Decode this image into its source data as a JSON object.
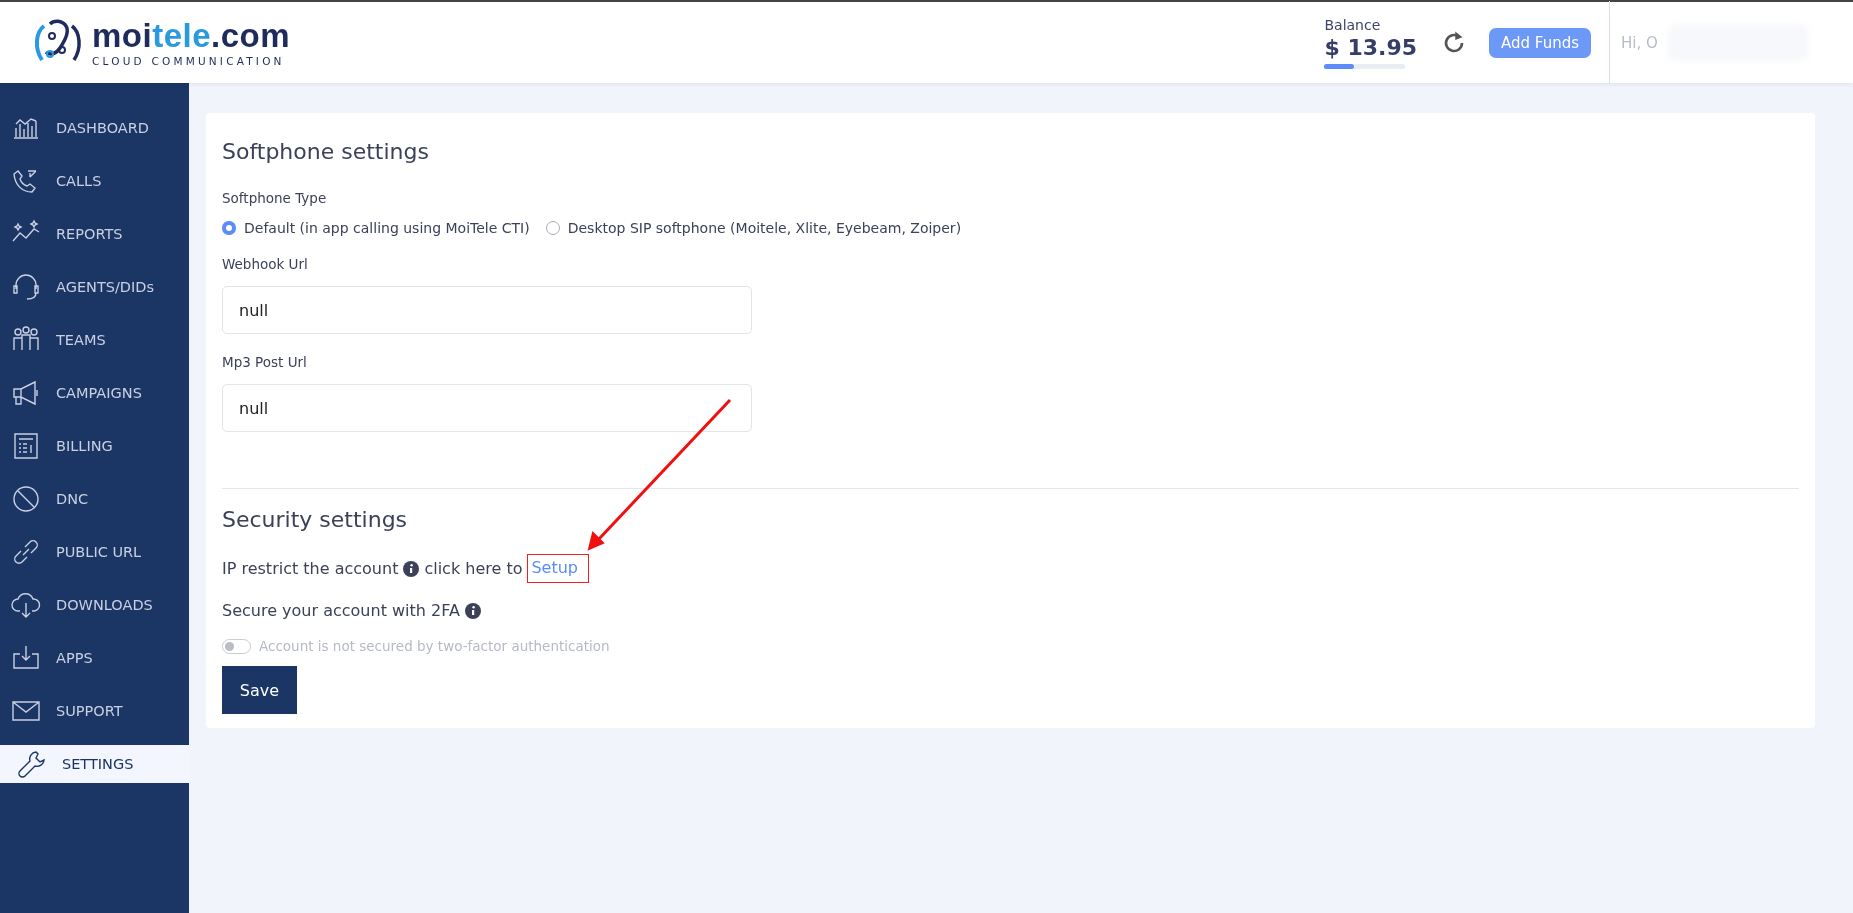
{
  "header": {
    "logo": {
      "name_parts": [
        {
          "text": "moi",
          "accent": false
        },
        {
          "text": "tele",
          "accent": true
        },
        {
          "text": ".com",
          "accent": false
        }
      ],
      "tagline": "CLOUD COMMUNICATION"
    },
    "balance": {
      "label": "Balance",
      "amount": "$ 13.95",
      "level": 0.37
    },
    "add_funds": "Add Funds",
    "greeting": "Hi, O"
  },
  "sidebar": {
    "items": [
      {
        "label": "DASHBOARD",
        "selected": false
      },
      {
        "label": "CALLS",
        "selected": false
      },
      {
        "label": "REPORTS",
        "selected": false
      },
      {
        "label": "AGENTS/DIDs",
        "selected": false
      },
      {
        "label": "TEAMS",
        "selected": false
      },
      {
        "label": "CAMPAIGNS",
        "selected": false
      },
      {
        "label": "BILLING",
        "selected": false
      },
      {
        "label": "DNC",
        "selected": false
      },
      {
        "label": "PUBLIC URL",
        "selected": false
      },
      {
        "label": "DOWNLOADS",
        "selected": false
      },
      {
        "label": "APPS",
        "selected": false
      },
      {
        "label": "SUPPORT",
        "selected": false
      },
      {
        "label": "SETTINGS",
        "selected": true
      }
    ]
  },
  "softphone": {
    "title": "Softphone settings",
    "type_label": "Softphone Type",
    "options": [
      {
        "label": "Default (in app calling using MoiTele CTI)",
        "selected": true
      },
      {
        "label": "Desktop SIP softphone (Moitele, Xlite, Eyebeam, Zoiper)",
        "selected": false
      }
    ],
    "fields": [
      {
        "label": "Webhook Url",
        "value": "null"
      },
      {
        "label": "Mp3 Post Url",
        "value": "null"
      }
    ]
  },
  "security": {
    "title": "Security settings",
    "ip_text": "IP restrict the account",
    "ip_link_prefix": "click here to",
    "setup_link": {
      "text": "Setup",
      "highlighted": true
    },
    "twofa_text": "Secure your account with 2FA",
    "twofa_toggle": {
      "label": "Account is not secured by two-factor authentication",
      "on": false
    },
    "save": "Save"
  }
}
